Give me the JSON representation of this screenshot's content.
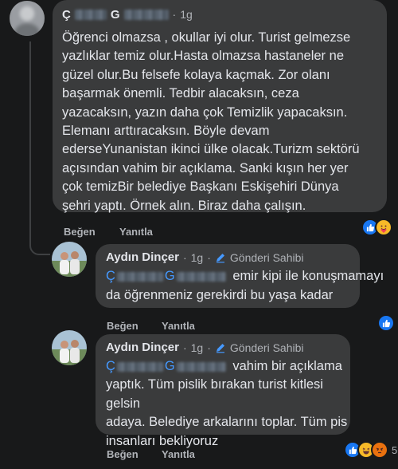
{
  "comments": [
    {
      "author_initials": [
        "Ç",
        "G"
      ],
      "time": "1g",
      "text": "Öğrenci olmazsa , okullar iyi olur. Turist gelmezse yazlıklar temiz olur.Hasta olmazsa hastaneler ne güzel olur.Bu felsefe kolaya kaçmak. Zor olanı başarmak önemli. Tedbir alacaksın, ceza yazacaksın, yazın daha çok Temizlik yapacaksın. Elemanı arttıracaksın. Böyle devam ederseYunanistan ikinci ülke olacak.Turizm sektörü açısından vahim bir açıklama. Sanki kışın her yer çok temizBir belediye Başkanı Eskişehiri  Dünya şehri yaptı. Örnek alın. Biraz daha çalışın.",
      "lines": [
        "Öğrenci olmazsa , okullar iyi olur. Turist gelmezse",
        "yazlıklar temiz olur.Hasta olmazsa hastaneler ne",
        "güzel olur.Bu felsefe kolaya kaçmak. Zor olanı",
        "başarmak önemli. Tedbir alacaksın, ceza",
        "yazacaksın, yazın daha çok Temizlik yapacaksın.",
        "Elemanı arttıracaksın. Böyle devam",
        "ederseYunanistan ikinci ülke olacak.Turizm sektörü",
        "açısından vahim bir açıklama. Sanki kışın her yer",
        "çok temizBir belediye Başkanı Eskişehiri  Dünya",
        "şehri yaptı. Örnek alın. Biraz daha çalışın."
      ],
      "like_label": "Beğen",
      "reply_label": "Yanıtla",
      "reactions": [
        "like-icon",
        "care-icon"
      ]
    },
    {
      "author": "Aydın Dinçer",
      "time": "1g",
      "badge": "Gönderi Sahibi",
      "mention_initials": [
        "Ç",
        "G"
      ],
      "line1": "emir kipi ile konuşmamayı",
      "line2": "da öğrenmeniz gerekirdi bu yaşa kadar",
      "like_label": "Beğen",
      "reply_label": "Yanıtla",
      "reactions": [
        "like-icon"
      ]
    },
    {
      "author": "Aydın Dinçer",
      "time": "1g",
      "badge": "Gönderi Sahibi",
      "mention_initials": [
        "Ç",
        "G"
      ],
      "line1": "vahim bir açıklama",
      "lines": [
        "yaptık. Tüm pislik bırakan turist kitlesi gelsin",
        "adaya. Belediye arkalarını toplar. Tüm pis",
        "insanları bekliyoruz"
      ],
      "like_label": "Beğen",
      "reply_label": "Yanıtla",
      "reactions": [
        "like-icon",
        "haha-icon",
        "angry-icon"
      ],
      "reaction_count": "5"
    }
  ],
  "separator": "·",
  "colors": {
    "background": "#18191a",
    "bubble": "#3a3b3c",
    "text": "#e4e6eb",
    "secondary": "#b0b3b8",
    "mention": "#4599ff",
    "like_blue": "#1877f2"
  }
}
